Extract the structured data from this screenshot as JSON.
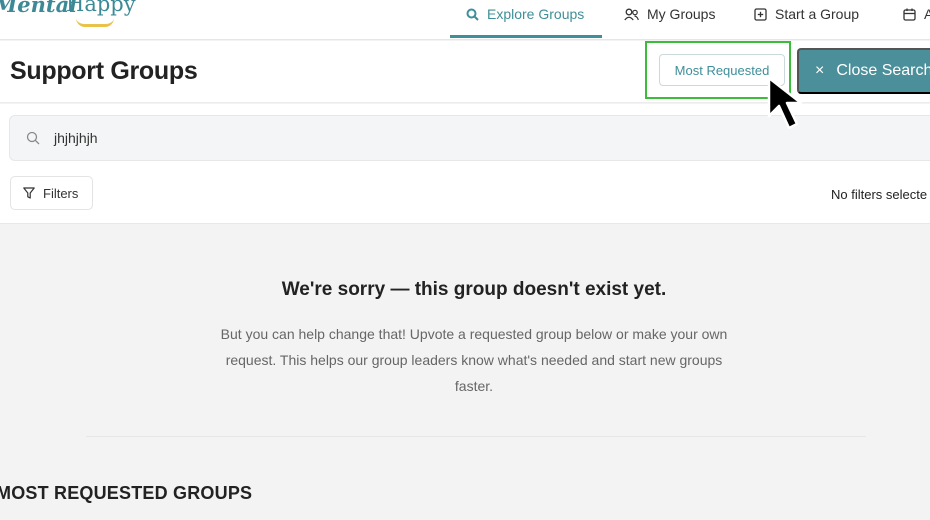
{
  "brand": {
    "logo_word1": "Mental",
    "logo_word2": "Happy"
  },
  "nav": {
    "items": [
      {
        "label": "Explore Groups",
        "icon": "search-group-icon"
      },
      {
        "label": "My Groups",
        "icon": "people-icon"
      },
      {
        "label": "Start a Group",
        "icon": "plus-square-icon"
      },
      {
        "label": "A",
        "icon": "calendar-icon"
      }
    ]
  },
  "header": {
    "title": "Support Groups",
    "most_requested_label": "Most Requested",
    "close_search_label": "Close Search",
    "close_icon": "×"
  },
  "search": {
    "value": "jhjhjhjh",
    "icon": "search-icon"
  },
  "filters": {
    "button_label": "Filters",
    "status": "No filters selecte"
  },
  "empty_state": {
    "title": "We're sorry — this group doesn't exist yet.",
    "body": "But you can help change that! Upvote a requested group below or make your own request. This helps our group leaders know what's needed and start new groups faster."
  },
  "section": {
    "title": "MOST REQUESTED GROUPS"
  },
  "colors": {
    "accent": "#3f8f9a",
    "button_bg": "#4a8f99",
    "highlight": "#3bbd3b",
    "logo_smile": "#e9c24a"
  }
}
